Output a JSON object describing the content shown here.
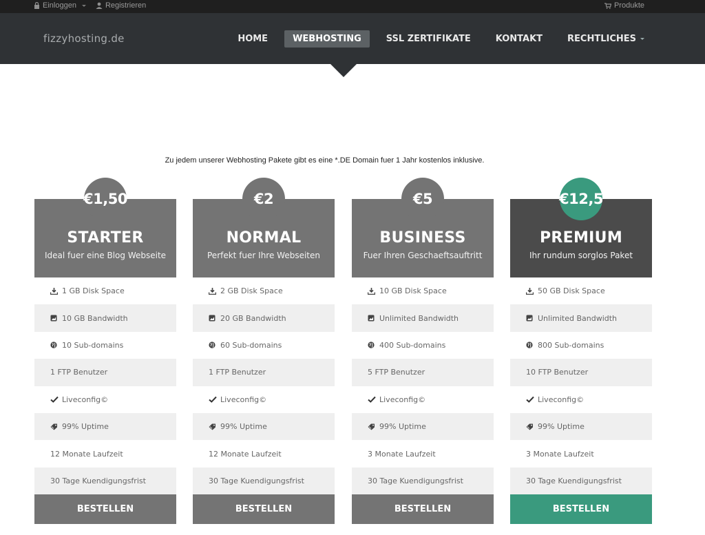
{
  "topbar": {
    "login": "Einloggen",
    "register": "Registrieren",
    "products": "Produkte"
  },
  "header": {
    "logo": "fizzyhosting.de",
    "nav": [
      "HOME",
      "WEBHOSTING",
      "SSL ZERTIFIKATE",
      "KONTAKT",
      "RECHTLICHES"
    ],
    "active_nav": "WEBHOSTING"
  },
  "intro": "Zu jedem unserer Webhosting Pakete gibt es eine *.DE Domain fuer 1 Jahr kostenlos inklusive.",
  "plans": [
    {
      "price": "€1,50",
      "name": "STARTER",
      "tagline": "Ideal fuer eine Blog Webseite",
      "disk": "1 GB Disk Space",
      "bandwidth": "10 GB Bandwidth",
      "subdomains": "10 Sub-domains",
      "ftp": "1 FTP Benutzer",
      "panel": "Liveconfig©",
      "uptime": "99% Uptime",
      "term": "12 Monate Laufzeit",
      "notice": "30 Tage Kuendigungsfrist",
      "button": "BESTELLEN"
    },
    {
      "price": "€2",
      "name": "NORMAL",
      "tagline": "Perfekt fuer Ihre Webseiten",
      "disk": "2 GB Disk Space",
      "bandwidth": "20 GB Bandwidth",
      "subdomains": "60 Sub-domains",
      "ftp": "1 FTP Benutzer",
      "panel": "Liveconfig©",
      "uptime": "99% Uptime",
      "term": "12 Monate Laufzeit",
      "notice": "30 Tage Kuendigungsfrist",
      "button": "BESTELLEN"
    },
    {
      "price": "€5",
      "name": "BUSINESS",
      "tagline": "Fuer Ihren Geschaeftsauftritt",
      "disk": "10 GB Disk Space",
      "bandwidth": "Unlimited Bandwidth",
      "subdomains": "400 Sub-domains",
      "ftp": "5 FTP Benutzer",
      "panel": "Liveconfig©",
      "uptime": "99% Uptime",
      "term": "3 Monate Laufzeit",
      "notice": "30 Tage Kuendigungsfrist",
      "button": "BESTELLEN"
    },
    {
      "price": "€12,5",
      "name": "PREMIUM",
      "tagline": "Ihr rundum sorglos Paket",
      "disk": "50 GB Disk Space",
      "bandwidth": "Unlimited Bandwidth",
      "subdomains": "800 Sub-domains",
      "ftp": "10 FTP Benutzer",
      "panel": "Liveconfig©",
      "uptime": "99% Uptime",
      "term": "3 Monate Laufzeit",
      "notice": "30 Tage Kuendigungsfrist",
      "button": "BESTELLEN"
    }
  ],
  "colors": {
    "topbar_bg": "#1f1f1f",
    "header_bg": "#2f3235",
    "plan_gray": "#747474",
    "premium_head": "#4b4b4b",
    "premium_accent": "#3a9a7e",
    "row_stripe": "#efefef"
  },
  "icons": {
    "disk": "download-icon",
    "bandwidth": "picture-icon",
    "subdomains": "globe-icon",
    "panel": "checkmark-icon",
    "uptime": "tag-icon",
    "login": "lock-icon",
    "register": "user-icon",
    "products": "cart-icon"
  }
}
